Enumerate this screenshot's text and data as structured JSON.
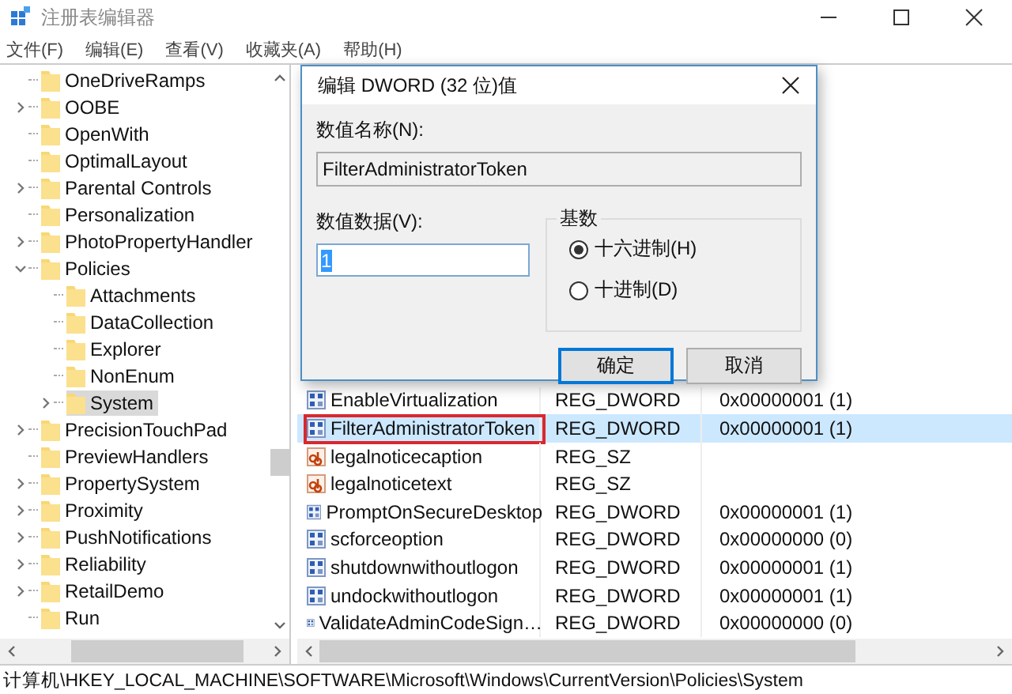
{
  "window": {
    "title": "注册表编辑器"
  },
  "menu": [
    "文件(F)",
    "编辑(E)",
    "查看(V)",
    "收藏夹(A)",
    "帮助(H)"
  ],
  "tree": {
    "items": [
      {
        "label": "OneDriveRamps",
        "selected": false
      },
      {
        "label": "OOBE",
        "expanded": false,
        "selected": false
      },
      {
        "label": "OpenWith",
        "selected": false
      },
      {
        "label": "OptimalLayout",
        "selected": false
      },
      {
        "label": "Parental Controls",
        "expanded": false,
        "selected": false
      },
      {
        "label": "Personalization",
        "selected": false
      },
      {
        "label": "PhotoPropertyHandler",
        "expanded": false,
        "selected": false
      },
      {
        "label": "Policies",
        "expanded": true,
        "selected": false,
        "children": [
          {
            "label": "Attachments",
            "selected": false
          },
          {
            "label": "DataCollection",
            "selected": false
          },
          {
            "label": "Explorer",
            "selected": false
          },
          {
            "label": "NonEnum",
            "selected": false
          },
          {
            "label": "System",
            "expanded": false,
            "selected": true
          }
        ]
      },
      {
        "label": "PrecisionTouchPad",
        "expanded": false,
        "selected": false
      },
      {
        "label": "PreviewHandlers",
        "selected": false
      },
      {
        "label": "PropertySystem",
        "expanded": false,
        "selected": false
      },
      {
        "label": "Proximity",
        "expanded": false,
        "selected": false
      },
      {
        "label": "PushNotifications",
        "expanded": false,
        "selected": false
      },
      {
        "label": "Reliability",
        "expanded": false,
        "selected": false
      },
      {
        "label": "RetailDemo",
        "expanded": false,
        "selected": false
      },
      {
        "label": "Run",
        "selected": false
      }
    ]
  },
  "values": {
    "rows": [
      {
        "kind": "dword",
        "name": "EnableVirtualization",
        "type": "REG_DWORD",
        "data": "0x00000001 (1)",
        "selected": false,
        "marked": false
      },
      {
        "kind": "dword",
        "name": "FilterAdministratorToken",
        "type": "REG_DWORD",
        "data": "0x00000001 (1)",
        "selected": true,
        "marked": true
      },
      {
        "kind": "string",
        "name": "legalnoticecaption",
        "type": "REG_SZ",
        "selected": false,
        "marked": false
      },
      {
        "kind": "string",
        "name": "legalnoticetext",
        "type": "REG_SZ",
        "selected": false,
        "marked": false
      },
      {
        "kind": "dword",
        "name": "PromptOnSecureDesktop",
        "type": "REG_DWORD",
        "data": "0x00000001 (1)",
        "selected": false,
        "marked": false
      },
      {
        "kind": "dword",
        "name": "scforceoption",
        "type": "REG_DWORD",
        "data": "0x00000000 (0)",
        "selected": false,
        "marked": false
      },
      {
        "kind": "dword",
        "name": "shutdownwithoutlogon",
        "type": "REG_DWORD",
        "data": "0x00000001 (1)",
        "selected": false,
        "marked": false
      },
      {
        "kind": "dword",
        "name": "undockwithoutlogon",
        "type": "REG_DWORD",
        "data": "0x00000001 (1)",
        "selected": false,
        "marked": false
      },
      {
        "kind": "dword",
        "name": "ValidateAdminCodeSign…",
        "type": "REG_DWORD",
        "data": "0x00000000 (0)",
        "selected": false,
        "marked": false
      }
    ]
  },
  "dialog": {
    "title": "编辑 DWORD (32 位)值",
    "name_label": "数值名称(N):",
    "name_value": "FilterAdministratorToken",
    "data_label": "数值数据(V):",
    "data_value": "1",
    "data_value_selected": true,
    "base": {
      "label": "基数",
      "options": [
        {
          "label": "十六进制(H)",
          "selected": true
        },
        {
          "label": "十进制(D)",
          "selected": false
        }
      ]
    },
    "buttons": [
      {
        "label": "确定",
        "default": true
      },
      {
        "label": "取消",
        "default": false
      }
    ]
  },
  "status_bar": "计算机\\HKEY_LOCAL_MACHINE\\SOFTWARE\\Microsoft\\Windows\\CurrentVersion\\Policies\\System"
}
